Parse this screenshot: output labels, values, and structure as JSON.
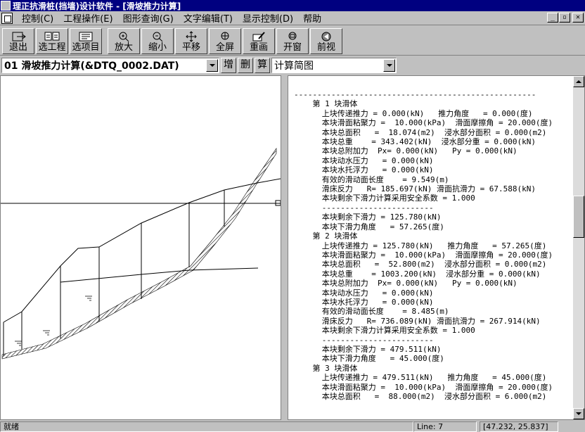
{
  "window": {
    "title": "理正抗滑桩(挡墙)设计软件 - [滑坡推力计算]"
  },
  "menu": {
    "items": [
      "控制(C)",
      "工程操作(E)",
      "图形查询(G)",
      "文字编辑(T)",
      "显示控制(D)",
      "帮助"
    ]
  },
  "window_buttons": {
    "minimize": "_",
    "restore": "▫",
    "close": "✕"
  },
  "toolbar": {
    "buttons": [
      {
        "label": "退出",
        "icon": "exit-icon"
      },
      {
        "label": "选工程",
        "icon": "project-select-icon"
      },
      {
        "label": "选项目",
        "icon": "item-select-icon"
      },
      {
        "label": "放大",
        "icon": "zoom-in-icon"
      },
      {
        "label": "缩小",
        "icon": "zoom-out-icon"
      },
      {
        "label": "平移",
        "icon": "pan-icon"
      },
      {
        "label": "全屏",
        "icon": "fullscreen-icon"
      },
      {
        "label": "重画",
        "icon": "redraw-icon"
      },
      {
        "label": "开窗",
        "icon": "window-zoom-icon"
      },
      {
        "label": "前视",
        "icon": "previous-view-icon"
      }
    ]
  },
  "selector": {
    "project_value": "01 滑坡推力计算(&DTQ_0002.DAT)",
    "add_label": "增",
    "delete_label": "删",
    "calc_label": "算",
    "view_value": "计算简图"
  },
  "report": {
    "lines": [
      "----------------------------------------------------",
      "    第 1 块滑体",
      "      上块传递推力 = 0.000(kN)   推力角度   = 0.000(度)",
      "      本块滑面粘聚力 =  10.000(kPa)  滑面摩擦角 = 20.000(度)",
      "      本块总面积   =  18.074(m2)  浸水部分面积 = 0.000(m2)",
      "      本块总重    = 343.402(kN)  浸水部分重 = 0.000(kN)",
      "      本块总附加力  Px= 0.000(kN)   Py = 0.000(kN)",
      "      本块动水压力   = 0.000(kN)",
      "      本块水托浮力   = 0.000(kN)",
      "      有效的滑动面长度    = 9.549(m)",
      "      滑床反力   R= 185.697(kN) 滑面抗滑力 = 67.588(kN)",
      "      本块剩余下滑力计算采用安全系数 = 1.000",
      "      ------------------------",
      "      本块剩余下滑力 = 125.780(kN)",
      "      本块下滑力角度   = 57.265(度)",
      "    第 2 块滑体",
      "      上块传递推力 = 125.780(kN)   推力角度   = 57.265(度)",
      "      本块滑面粘聚力 =  10.000(kPa)  滑面摩擦角 = 20.000(度)",
      "      本块总面积   =  52.800(m2)  浸水部分面积 = 0.000(m2)",
      "      本块总重    = 1003.200(kN)  浸水部分重 = 0.000(kN)",
      "      本块总附加力  Px= 0.000(kN)   Py = 0.000(kN)",
      "      本块动水压力   = 0.000(kN)",
      "      本块水托浮力   = 0.000(kN)",
      "      有效的滑动面长度    = 8.485(m)",
      "      滑床反力   R= 736.089(kN) 滑面抗滑力 = 267.914(kN)",
      "      本块剩余下滑力计算采用安全系数 = 1.000",
      "      ------------------------",
      "      本块剩余下滑力 = 479.511(kN)",
      "      本块下滑力角度   = 45.000(度)",
      "    第 3 块滑体",
      "      上块传递推力 = 479.511(kN)   推力角度   = 45.000(度)",
      "      本块滑面粘聚力 =  10.000(kPa)  滑面摩擦角 = 20.000(度)",
      "      本块总面积   =  88.000(m2)  浸水部分面积 = 6.000(m2)"
    ]
  },
  "status": {
    "message": "就绪",
    "line": "Line: 7",
    "coords": "[47.232, 25.837]"
  }
}
